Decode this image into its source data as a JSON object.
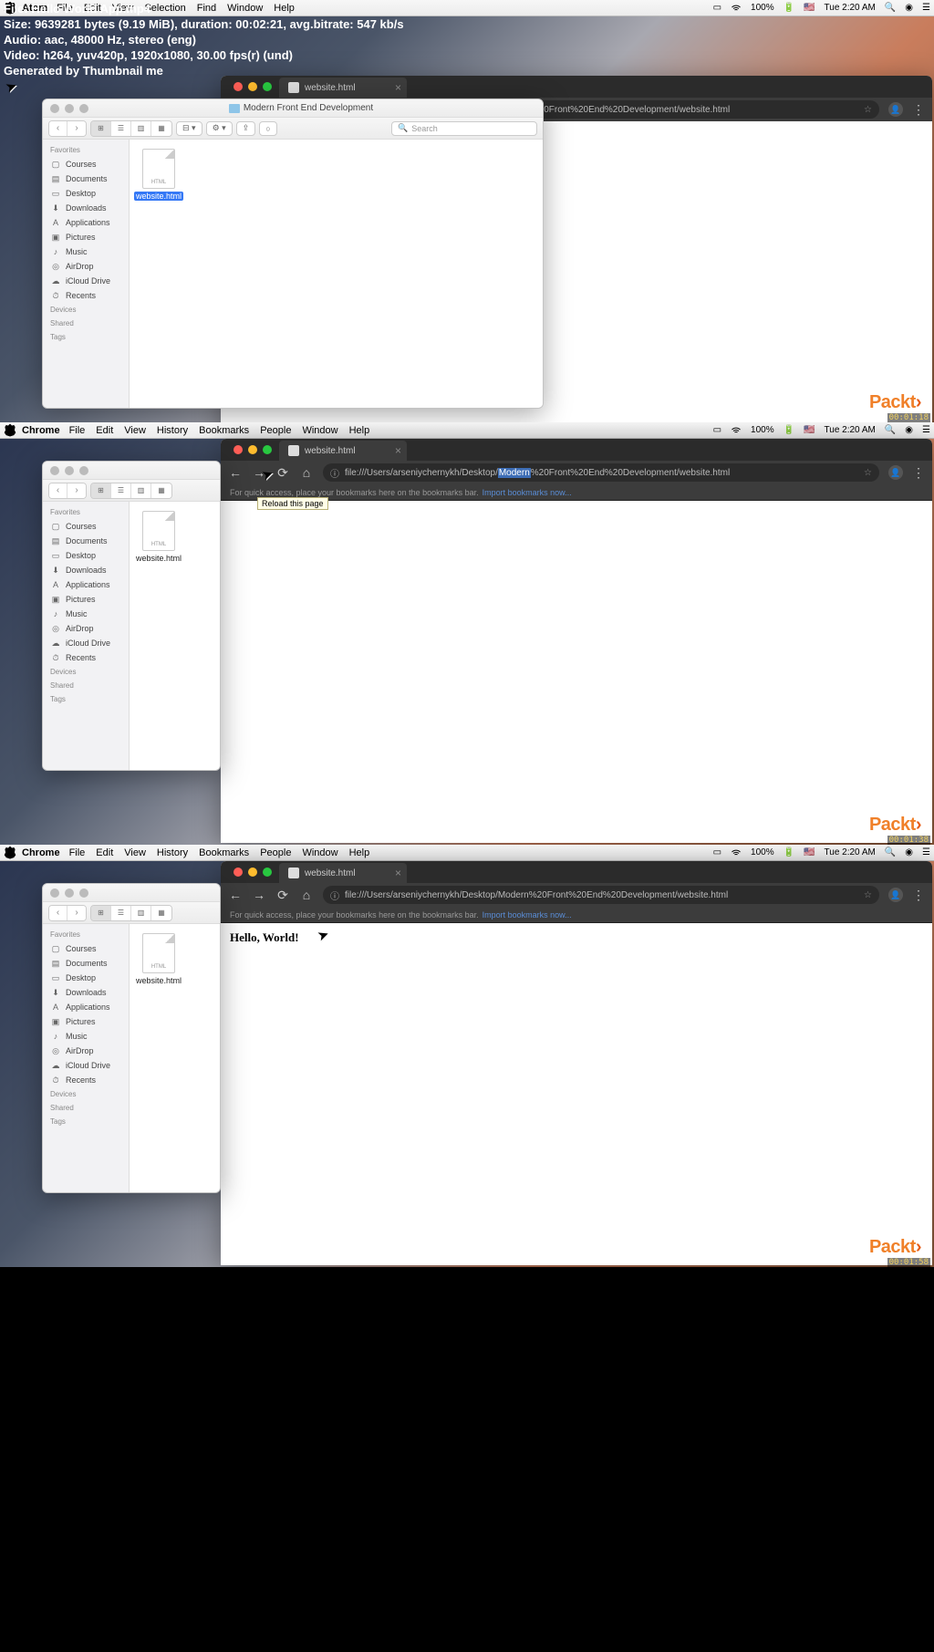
{
  "overlay": {
    "line1": "File: Hello World App.mp4",
    "line2": "Size: 9639281 bytes (9.19 MiB), duration: 00:02:21, avg.bitrate: 547 kb/s",
    "line3": "Audio: aac, 48000 Hz, stereo (eng)",
    "line4": "Video: h264, yuv420p, 1920x1080, 30.00 fps(r) (und)",
    "line5": "Generated by Thumbnail me"
  },
  "menubar": {
    "atom": {
      "app": "Atom",
      "items": [
        "File",
        "Edit",
        "View",
        "Selection",
        "Find",
        "Window",
        "Help"
      ]
    },
    "chrome": {
      "app": "Chrome",
      "items": [
        "File",
        "Edit",
        "View",
        "History",
        "Bookmarks",
        "People",
        "Window",
        "Help"
      ]
    },
    "battery": "100%",
    "time": "Tue 2:20 AM"
  },
  "chrome": {
    "tab_title": "website.html",
    "url_prefix": "file:///Users/arseniychernykh/Desktop/",
    "url_sel": "Modern",
    "url_suffix": "%20Front%20End%20Development/website.html",
    "url_full": "file:///Users/arseniychernykh/Desktop/Modern%20Front%20End%20Development/website.html",
    "bm_text": "For quick access, place your bookmarks here on the bookmarks bar.",
    "bm_link": "Import bookmarks now...",
    "tooltip": "Reload this page",
    "content_hello": "Hello, World!"
  },
  "finder": {
    "title": "Modern Front End Development",
    "search_ph": "Search",
    "file_name": "website.html",
    "file_badge": "HTML",
    "sections": {
      "favorites": "Favorites",
      "devices": "Devices",
      "shared": "Shared",
      "tags": "Tags"
    },
    "items": [
      "Courses",
      "Documents",
      "Desktop",
      "Downloads",
      "Applications",
      "Pictures",
      "Music",
      "AirDrop",
      "iCloud Drive",
      "Recents"
    ]
  },
  "packt": {
    "name": "Packt",
    "bracket": "›"
  },
  "timestamps": [
    "00:01:18",
    "00:01:38",
    "00:01:58"
  ]
}
